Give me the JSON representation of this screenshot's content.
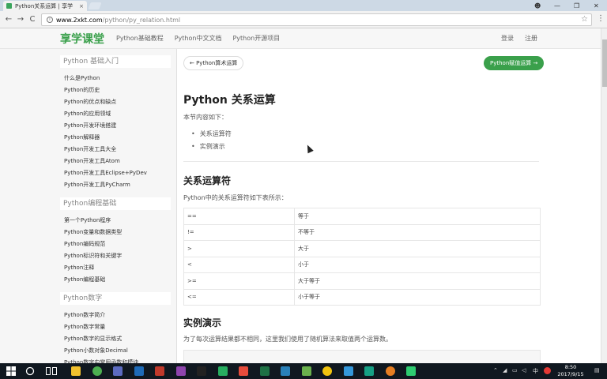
{
  "browser": {
    "tab_title": "Python关系运算 | 享学",
    "tab_close": "×",
    "url_host": "www.2xkt.com",
    "url_path": "/python/py_relation.html",
    "back": "←",
    "forward": "→",
    "reload": "C",
    "star": "☆",
    "menu": "⋮",
    "win_user": "☻",
    "win_min": "—",
    "win_max": "❐",
    "win_close": "✕"
  },
  "site": {
    "logo": "享学课堂",
    "nav": [
      "Python基础教程",
      "Python中文文档",
      "Python开源项目"
    ],
    "login": "登录",
    "register": "注册",
    "accent": "#3aa04b"
  },
  "sidebar": {
    "sections": [
      {
        "title": "Python 基础入门",
        "items": [
          "什么是Python",
          "Python的历史",
          "Python的优点和缺点",
          "Python的应用领域",
          "Python开发环境搭建",
          "Python解释器",
          "Python开发工具大全",
          "Python开发工具Atom",
          "Python开发工具Eclipse+PyDev",
          "Python开发工具PyCharm"
        ]
      },
      {
        "title": "Python编程基础",
        "items": [
          "第一个Python程序",
          "Python变量和数据类型",
          "Python编码规范",
          "Python标识符和关键字",
          "Python注释",
          "Python编程基础"
        ]
      },
      {
        "title": "Python数字",
        "items": [
          "Python数字简介",
          "Python数字常量",
          "Python数字的显示格式",
          "Python小数对象Decimal",
          "Python数字中常用函数和模块"
        ]
      }
    ]
  },
  "main": {
    "prev_label": "← Python算术运算",
    "next_label": "Python赋值运算 →",
    "title": "Python 关系运算",
    "intro": "本节内容如下：",
    "toc": [
      "关系运算符",
      "实例演示"
    ],
    "section1_title": "关系运算符",
    "section1_text": "Python中的关系运算符如下表所示：",
    "operators": [
      {
        "op": "==",
        "desc": "等于"
      },
      {
        "op": "!=",
        "desc": "不等于"
      },
      {
        "op": ">",
        "desc": "大于"
      },
      {
        "op": "<",
        "desc": "小于"
      },
      {
        "op": ">=",
        "desc": "大于等于"
      },
      {
        "op": "<=",
        "desc": "小于等于"
      }
    ],
    "section2_title": "实例演示",
    "section2_text": "为了每次运算结果都不相同，这里我们使用了随机算法来取值两个运算数。"
  },
  "taskbar": {
    "time": "8:50",
    "date": "2017/9/15",
    "ime": "中",
    "icons": [
      {
        "name": "folder",
        "color": "#f2c12e"
      },
      {
        "name": "chrome",
        "color": "#4caf50"
      },
      {
        "name": "media",
        "color": "#5c6bc0"
      },
      {
        "name": "photoshop",
        "color": "#1e6bb8"
      },
      {
        "name": "app",
        "color": "#c0392b"
      },
      {
        "name": "app2",
        "color": "#8e44ad"
      },
      {
        "name": "terminal",
        "color": "#222222"
      },
      {
        "name": "panel",
        "color": "#27ae60"
      },
      {
        "name": "media2",
        "color": "#e74c3c"
      },
      {
        "name": "excel",
        "color": "#1e7145"
      },
      {
        "name": "image",
        "color": "#2980b9"
      },
      {
        "name": "app3",
        "color": "#6ab04c"
      },
      {
        "name": "chrome2",
        "color": "#f1c40f"
      },
      {
        "name": "app4",
        "color": "#3498db"
      },
      {
        "name": "app5",
        "color": "#16a085"
      },
      {
        "name": "chrome3",
        "color": "#e67e22"
      },
      {
        "name": "app6",
        "color": "#2ecc71"
      }
    ]
  }
}
